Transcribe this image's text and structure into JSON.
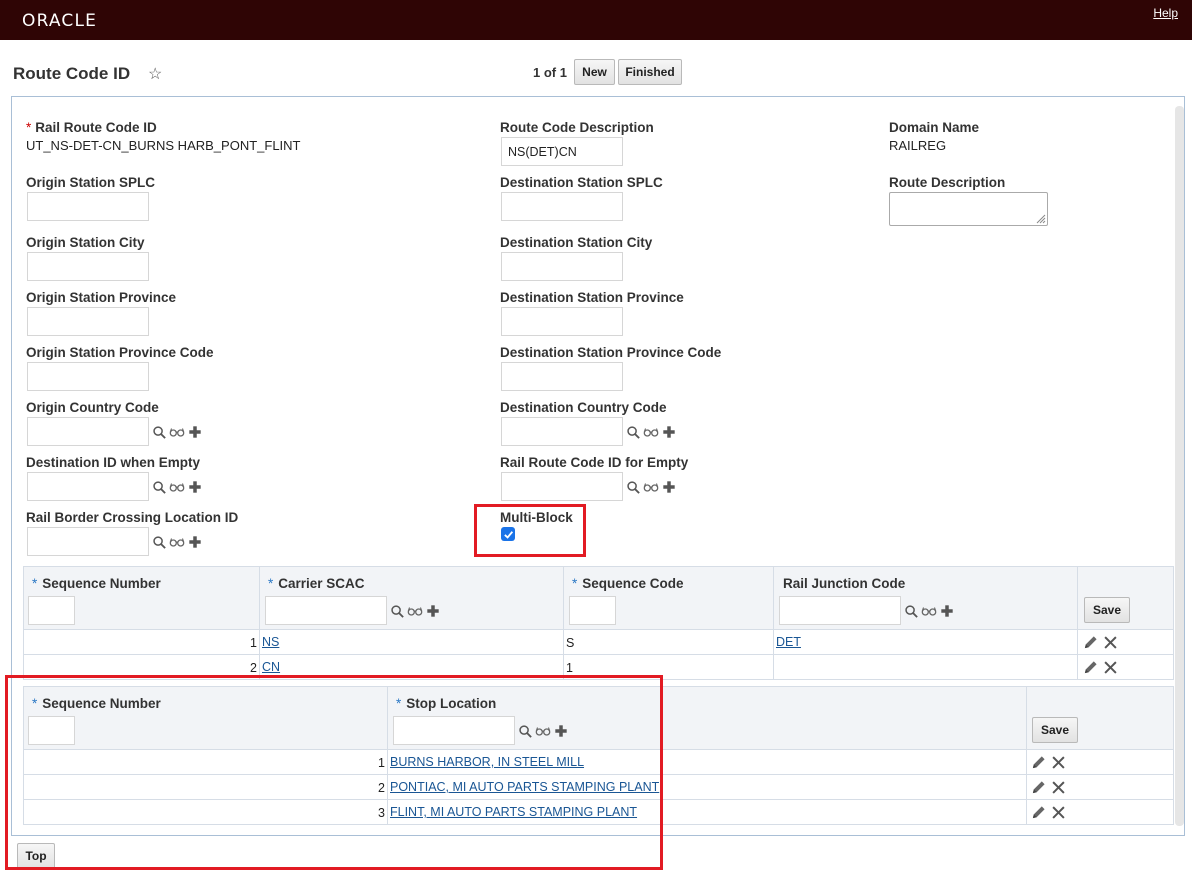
{
  "header": {
    "logo": "ORACLE",
    "help": "Help"
  },
  "page": {
    "title": "Route Code ID",
    "pager": "1 of 1",
    "new_button": "New",
    "finished_button": "Finished"
  },
  "fields": {
    "rail_route_code_id": {
      "label": "Rail Route Code ID",
      "value": "UT_NS-DET-CN_BURNS HARB_PONT_FLINT"
    },
    "route_code_description": {
      "label": "Route Code Description",
      "value": "NS(DET)CN"
    },
    "domain_name": {
      "label": "Domain Name",
      "value": "RAILREG"
    },
    "origin_station_splc": {
      "label": "Origin Station SPLC",
      "value": ""
    },
    "destination_station_splc": {
      "label": "Destination Station SPLC",
      "value": ""
    },
    "route_description": {
      "label": "Route Description",
      "value": ""
    },
    "origin_station_city": {
      "label": "Origin Station City",
      "value": ""
    },
    "destination_station_city": {
      "label": "Destination Station City",
      "value": ""
    },
    "origin_station_province": {
      "label": "Origin Station Province",
      "value": ""
    },
    "destination_station_province": {
      "label": "Destination Station Province",
      "value": ""
    },
    "origin_station_province_code": {
      "label": "Origin Station Province Code",
      "value": ""
    },
    "destination_station_province_code": {
      "label": "Destination Station Province Code",
      "value": ""
    },
    "origin_country_code": {
      "label": "Origin Country Code",
      "value": ""
    },
    "destination_country_code": {
      "label": "Destination Country Code",
      "value": ""
    },
    "destination_id_when_empty": {
      "label": "Destination ID when Empty",
      "value": ""
    },
    "rail_route_code_id_for_empty": {
      "label": "Rail Route Code ID for Empty",
      "value": ""
    },
    "rail_border_crossing_location_id": {
      "label": "Rail Border Crossing Location ID",
      "value": ""
    },
    "multi_block": {
      "label": "Multi-Block",
      "checked": true
    }
  },
  "carrier_grid": {
    "columns": [
      "Sequence Number",
      "Carrier SCAC",
      "Sequence Code",
      "Rail Junction Code"
    ],
    "save_label": "Save",
    "rows": [
      {
        "seq": "1",
        "carrier": "NS",
        "seq_code": "S",
        "junction": "DET"
      },
      {
        "seq": "2",
        "carrier": "CN",
        "seq_code": "1",
        "junction": ""
      }
    ]
  },
  "stop_grid": {
    "columns": [
      "Sequence Number",
      "Stop Location"
    ],
    "save_label": "Save",
    "rows": [
      {
        "seq": "1",
        "location": "BURNS HARBOR, IN STEEL MILL"
      },
      {
        "seq": "2",
        "location": "PONTIAC, MI AUTO PARTS STAMPING PLANT"
      },
      {
        "seq": "3",
        "location": "FLINT, MI AUTO PARTS STAMPING PLANT"
      }
    ]
  },
  "footer": {
    "top_button": "Top"
  },
  "colors": {
    "header_bg": "#2f0505",
    "highlight": "#e21b23",
    "link": "#1a5694",
    "required_blue": "#2b78c5",
    "required_red": "#cc0000"
  },
  "icons": [
    "search-icon",
    "glasses-icon",
    "plus-icon",
    "pencil-icon",
    "delete-x-icon",
    "star-icon",
    "checkbox-icon",
    "resize-grip-icon"
  ]
}
